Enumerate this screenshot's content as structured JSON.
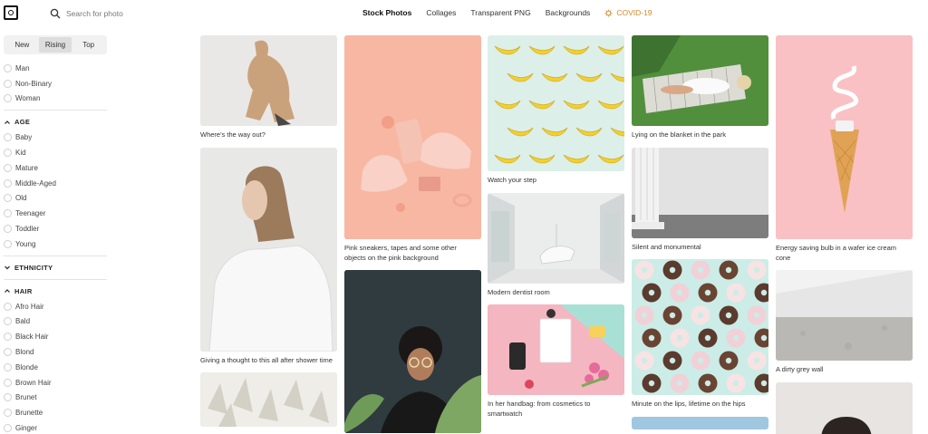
{
  "header": {
    "search_placeholder": "Search for photo",
    "nav": [
      "Stock Photos",
      "Collages",
      "Transparent PNG",
      "Backgrounds",
      "COVID-19"
    ]
  },
  "sidebar": {
    "tabs": [
      "New",
      "Rising",
      "Top"
    ],
    "gender": [
      "Man",
      "Non-Binary",
      "Woman"
    ],
    "age_title": "AGE",
    "age": [
      "Baby",
      "Kid",
      "Mature",
      "Middle-Aged",
      "Old",
      "Teenager",
      "Toddler",
      "Young"
    ],
    "ethnicity_title": "ETHNICITY",
    "hair_title": "HAIR",
    "hair": [
      "Afro Hair",
      "Bald",
      "Black Hair",
      "Blond",
      "Blonde",
      "Brown Hair",
      "Brunet",
      "Brunette",
      "Ginger"
    ]
  },
  "photos": {
    "c1": [
      "Where's the way out?",
      "Giving a thought to this all after shower time"
    ],
    "c2": [
      "Pink sneakers, tapes and some other objects on the pink background"
    ],
    "c3": [
      "Watch your step",
      "Modern dentist room",
      "In her handbag: from cosmetics to smartwatch"
    ],
    "c4": [
      "Lying on the blanket in the park",
      "Silent and monumental",
      "Minute on the lips, lifetime on the hips"
    ],
    "c5": [
      "Energy saving bulb in a wafer ice cream cone",
      "A dirty grey wall"
    ]
  },
  "colors": {
    "accent": "#d4882c",
    "tab_active": "#dddddd"
  }
}
